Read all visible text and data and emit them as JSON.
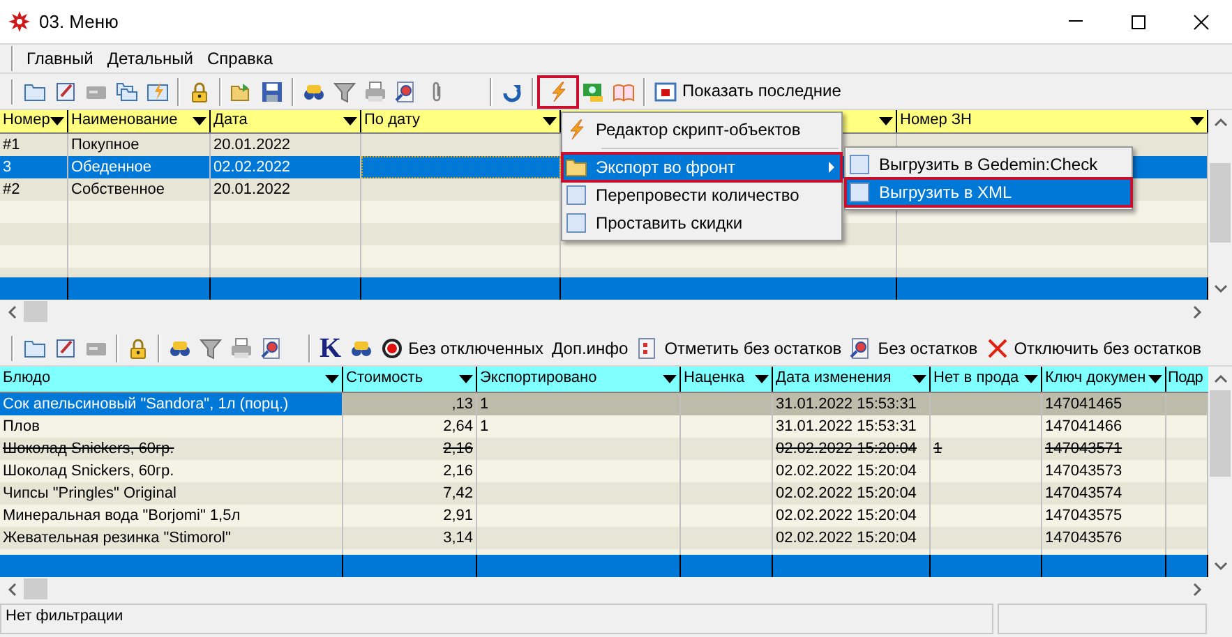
{
  "window": {
    "title": "03. Меню"
  },
  "menu": [
    "Главный",
    "Детальный",
    "Справка"
  ],
  "toolbar_top": {
    "script_button_highlighted": true,
    "show_last_button": "Показать последние"
  },
  "top_grid": {
    "columns": [
      {
        "label": "Номер"
      },
      {
        "label": "Наименование"
      },
      {
        "label": "Дата"
      },
      {
        "label": "По дату"
      },
      {},
      {
        "label": "Номер ЗН"
      }
    ],
    "rows": [
      {
        "number": "#1",
        "name": "Покупное",
        "date": "20.01.2022",
        "selected": false
      },
      {
        "number": "3",
        "name": "Обеденное",
        "date": "02.02.2022",
        "selected": true
      },
      {
        "number": "#2",
        "name": "Собственное",
        "date": "20.01.2022",
        "selected": false
      }
    ]
  },
  "context_menu": {
    "items": [
      {
        "kind": "item",
        "label": "Редактор скрипт-объектов",
        "selected": false,
        "highlighted": false,
        "has_submenu": false
      },
      {
        "kind": "separator"
      },
      {
        "kind": "item",
        "label": "Экспорт во фронт",
        "selected": true,
        "highlighted": true,
        "has_submenu": true
      },
      {
        "kind": "item",
        "label": "Перепровести количество",
        "selected": false,
        "highlighted": false,
        "has_submenu": false
      },
      {
        "kind": "item",
        "label": "Проставить скидки",
        "selected": false,
        "highlighted": false,
        "has_submenu": false
      }
    ],
    "submenu": [
      {
        "label": "Выгрузить в Gedemin:Check",
        "selected": false,
        "highlighted": false
      },
      {
        "label": "Выгрузить в XML",
        "selected": true,
        "highlighted": true
      }
    ]
  },
  "toolbar_bottom": {
    "k_button": "K",
    "buttons": [
      {
        "label": "Без отключенных"
      },
      {
        "label": "Доп.инфо"
      },
      {
        "label": "Отметить без остатков"
      },
      {
        "label": "Без остатков"
      },
      {
        "label": "Отключить без остатков"
      }
    ]
  },
  "bottom_grid": {
    "columns": [
      "Блюдо",
      "Стоимость",
      "Экспортировано",
      "Наценка",
      "Дата изменения",
      "Нет в прода",
      "Ключ докумен",
      "Подр"
    ],
    "rows": [
      {
        "dish": "Сок апельсиновый \"Sandora\", 1л (порц.)",
        "cost": ",13",
        "exported": "1",
        "changed": "31.01.2022 15:53:31",
        "doc_key": "147041465",
        "selected": true,
        "disabled": false
      },
      {
        "dish": "Плов",
        "cost": "2,64",
        "exported": "1",
        "changed": "31.01.2022 15:53:31",
        "doc_key": "147041466",
        "selected": false,
        "disabled": false
      },
      {
        "dish": "Шоколад Snickers, 60гр.",
        "cost": "2,16",
        "changed": "02.02.2022 15:20:04",
        "not_on_sale": "1",
        "doc_key": "147043571",
        "selected": false,
        "disabled": true
      },
      {
        "dish": "Шоколад Snickers, 60гр.",
        "cost": "2,16",
        "changed": "02.02.2022 15:20:04",
        "doc_key": "147043573",
        "selected": false,
        "disabled": false
      },
      {
        "dish": "Чипсы \"Pringles\" Original",
        "cost": "7,42",
        "changed": "02.02.2022 15:20:04",
        "doc_key": "147043574",
        "selected": false,
        "disabled": false
      },
      {
        "dish": "Минеральная вода \"Borjomi\" 1,5л",
        "cost": "2,91",
        "changed": "02.02.2022 15:20:04",
        "doc_key": "147043575",
        "selected": false,
        "disabled": false
      },
      {
        "dish": "Жевательная резинка \"Stimorol\"",
        "cost": "3,14",
        "changed": "02.02.2022 15:20:04",
        "doc_key": "147043576",
        "selected": false,
        "disabled": false
      }
    ]
  },
  "status_bar": {
    "text": "Нет фильтрации"
  }
}
